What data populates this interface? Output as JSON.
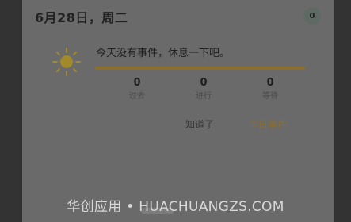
{
  "header": {
    "date_title": "6月28日，周二",
    "badge_count": "0"
  },
  "empty_state": {
    "message": "今天没有事件，休息一下吧。"
  },
  "stats": [
    {
      "value": "0",
      "label": "过去"
    },
    {
      "value": "0",
      "label": "进行"
    },
    {
      "value": "0",
      "label": "等待"
    }
  ],
  "actions": {
    "got_it": "知道了",
    "today_events": "今日事件"
  },
  "watermark": {
    "text": "华创应用 • HUACHUANGZS.COM"
  },
  "colors": {
    "accent": "#8a6e2e",
    "sun": "#a08a2a"
  },
  "icons": {
    "sun": "sun-icon"
  }
}
